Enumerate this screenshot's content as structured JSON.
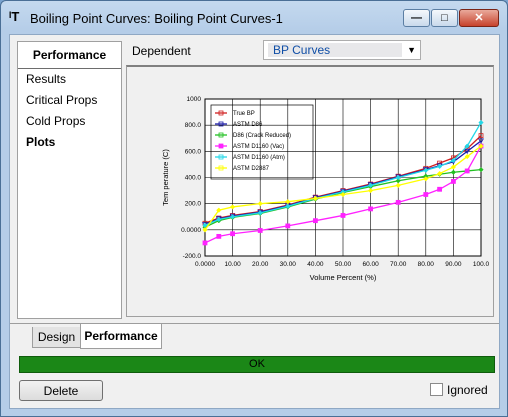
{
  "window": {
    "title": "Boiling Point Curves: Boiling Point Curves-1",
    "icon_text": "ᴵT",
    "controls": {
      "minimize": "—",
      "maximize": "□",
      "close": "✕"
    }
  },
  "nav": {
    "header": "Performance",
    "items": [
      {
        "label": "Results",
        "active": false
      },
      {
        "label": "Critical Props",
        "active": false
      },
      {
        "label": "Cold Props",
        "active": false
      },
      {
        "label": "Plots",
        "active": true
      }
    ]
  },
  "dependent": {
    "label": "Dependent",
    "value": "BP Curves"
  },
  "chart_data": {
    "type": "line",
    "title": "",
    "xlabel": "Volume Percent (%)",
    "ylabel": "Tem perature (C)",
    "xlim": [
      0,
      100
    ],
    "ylim": [
      -200,
      1000
    ],
    "xticks": [
      "0.0000",
      "10.00",
      "20.00",
      "30.00",
      "40.00",
      "50.00",
      "60.00",
      "70.00",
      "80.00",
      "90.00",
      "100.0"
    ],
    "yticks": [
      "-200.0",
      "0.0000",
      "200.0",
      "400.0",
      "600.0",
      "800.0",
      "1000"
    ],
    "grid": true,
    "legend_position": "top-left",
    "series": [
      {
        "name": "True BP",
        "color": "#d02020",
        "marker": "square-open",
        "x": [
          0,
          5,
          10,
          20,
          30,
          40,
          50,
          60,
          70,
          80,
          85,
          90,
          95,
          100
        ],
        "y": [
          50,
          90,
          110,
          140,
          190,
          250,
          300,
          350,
          410,
          470,
          510,
          550,
          620,
          720
        ]
      },
      {
        "name": "ASTM D86",
        "color": "#1a1aa8",
        "marker": "triangle-open",
        "x": [
          0,
          5,
          10,
          20,
          30,
          40,
          50,
          60,
          70,
          80,
          85,
          90,
          95,
          100
        ],
        "y": [
          40,
          85,
          105,
          135,
          185,
          245,
          295,
          345,
          405,
          460,
          490,
          520,
          600,
          680
        ]
      },
      {
        "name": "D86 (Crack Reduced)",
        "color": "#22c022",
        "marker": "diamond",
        "x": [
          0,
          5,
          10,
          20,
          30,
          40,
          50,
          60,
          70,
          80,
          85,
          90,
          95,
          100
        ],
        "y": [
          20,
          70,
          95,
          125,
          175,
          235,
          285,
          330,
          375,
          410,
          425,
          440,
          450,
          460
        ]
      },
      {
        "name": "ASTM D1160 (Vac)",
        "color": "#ff22ff",
        "marker": "square",
        "x": [
          0,
          5,
          10,
          20,
          30,
          40,
          50,
          60,
          70,
          80,
          85,
          90,
          95,
          100
        ],
        "y": [
          -100,
          -50,
          -30,
          -5,
          30,
          70,
          110,
          160,
          210,
          270,
          310,
          370,
          450,
          640
        ]
      },
      {
        "name": "ASTM D1160 (Atm)",
        "color": "#22d8e8",
        "marker": "diamond",
        "x": [
          0,
          5,
          10,
          20,
          30,
          40,
          50,
          60,
          70,
          80,
          85,
          90,
          95,
          100
        ],
        "y": [
          35,
          80,
          100,
          130,
          180,
          240,
          290,
          340,
          400,
          455,
          485,
          530,
          640,
          820
        ]
      },
      {
        "name": "ASTM D2887",
        "color": "#ffff00",
        "marker": "diamond",
        "x": [
          0,
          5,
          10,
          20,
          30,
          40,
          50,
          60,
          70,
          80,
          85,
          90,
          95,
          100
        ],
        "y": [
          0,
          150,
          175,
          200,
          215,
          240,
          270,
          300,
          340,
          390,
          430,
          480,
          560,
          640
        ]
      }
    ]
  },
  "tabs": [
    {
      "label": "Design",
      "active": false
    },
    {
      "label": "Performance",
      "active": true
    }
  ],
  "status": {
    "text": "OK",
    "color": "#1b8717"
  },
  "footer": {
    "delete_label": "Delete",
    "ignored_label": "Ignored"
  }
}
